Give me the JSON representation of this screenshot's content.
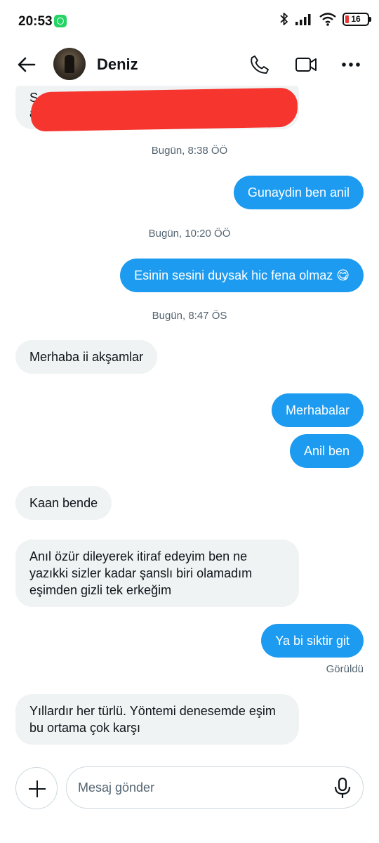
{
  "status_bar": {
    "time": "20:53",
    "battery": "16",
    "icons": [
      "whatsapp-icon",
      "bluetooth-icon",
      "signal-icon",
      "wifi-icon",
      "battery-icon"
    ]
  },
  "header": {
    "contact_name": "Deniz",
    "icons": [
      "back-arrow-icon",
      "phone-icon",
      "video-icon",
      "more-icon"
    ]
  },
  "chat": {
    "accent_color": "#1d9bf0",
    "incoming_color": "#eff3f4",
    "partial_message": {
      "line1": "S",
      "line2": "a"
    },
    "messages": [
      {
        "type": "timestamp",
        "text": "Bugün, 8:38 ÖÖ"
      },
      {
        "type": "out",
        "text": "Gunaydin ben anil"
      },
      {
        "type": "timestamp",
        "text": "Bugün, 10:20 ÖÖ"
      },
      {
        "type": "out",
        "text": "Esinin sesini duysak hic fena olmaz 😋"
      },
      {
        "type": "timestamp",
        "text": "Bugün, 8:47 ÖS"
      },
      {
        "type": "in",
        "text": "Merhaba ii akşamlar"
      },
      {
        "type": "out",
        "text": "Merhabalar"
      },
      {
        "type": "out",
        "text": "Anil ben"
      },
      {
        "type": "in",
        "text": "Kaan bende"
      },
      {
        "type": "in",
        "lines": [
          "Anıl özür dileyerek itiraf edeyim ben ne",
          "yazıkki sizler kadar şanslı biri olamadım",
          "eşimden gizli tek erkeğim"
        ]
      },
      {
        "type": "out",
        "text": "Ya bi siktir git"
      },
      {
        "type": "status",
        "text": "Görüldü"
      },
      {
        "type": "in",
        "lines": [
          "Yıllardır her türlü. Yöntemi denesemde eşim",
          "bu ortama çok karşı"
        ]
      }
    ]
  },
  "composer": {
    "placeholder": "Mesaj gönder",
    "value": "",
    "icons": [
      "plus-icon",
      "microphone-icon"
    ]
  }
}
